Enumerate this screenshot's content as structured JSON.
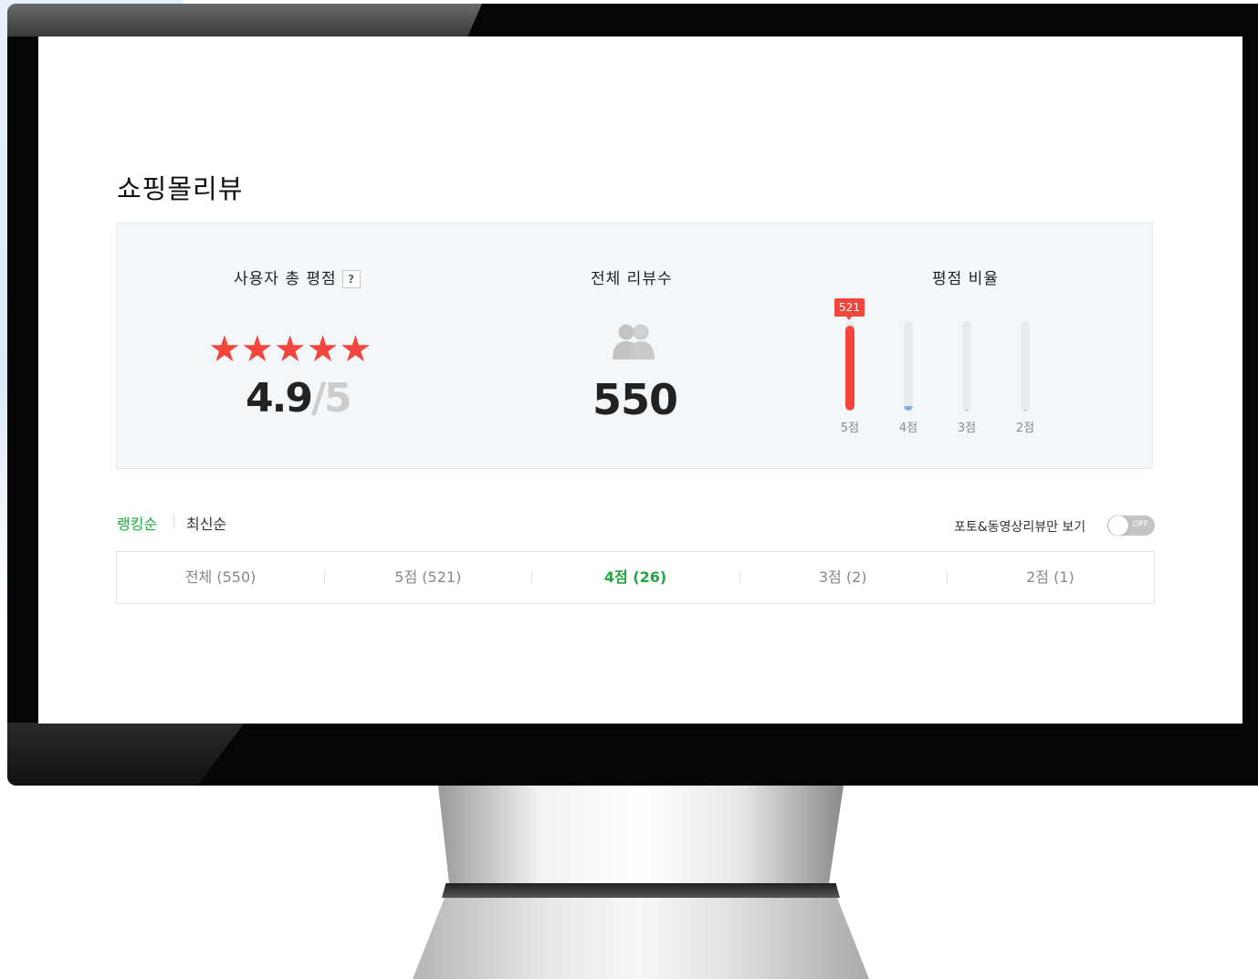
{
  "page": {
    "title": "쇼핑몰리뷰"
  },
  "summary": {
    "rating_label": "사용자 총 평점",
    "help_icon": "?",
    "stars": "★★★★★",
    "rating": "4.9",
    "rating_max": "/5",
    "total_label": "전체 리뷰수",
    "total_icon": "people-icon",
    "total": "550",
    "ratio_label": "평점 비율"
  },
  "ratio": {
    "highlight_value": "521",
    "bars": [
      {
        "label": "5점",
        "fraction": 0.947,
        "color": "#f2463d"
      },
      {
        "label": "4점",
        "fraction": 0.047,
        "color": "#7eaee3"
      },
      {
        "label": "3점",
        "fraction": 0.004,
        "color": "#7eaee3"
      },
      {
        "label": "2점",
        "fraction": 0.002,
        "color": "#7eaee3"
      }
    ]
  },
  "sort": {
    "ranking": "랭킹순",
    "latest": "최신순",
    "active_color": "#1fa83d"
  },
  "filter": {
    "label": "포토&동영상리뷰만 보기",
    "toggle_state": "OFF"
  },
  "tabs": [
    {
      "label": "전체 (550)",
      "active": false
    },
    {
      "label": "5점 (521)",
      "active": false
    },
    {
      "label": "4점 (26)",
      "active": true
    },
    {
      "label": "3점 (2)",
      "active": false
    },
    {
      "label": "2점 (1)",
      "active": false
    }
  ]
}
